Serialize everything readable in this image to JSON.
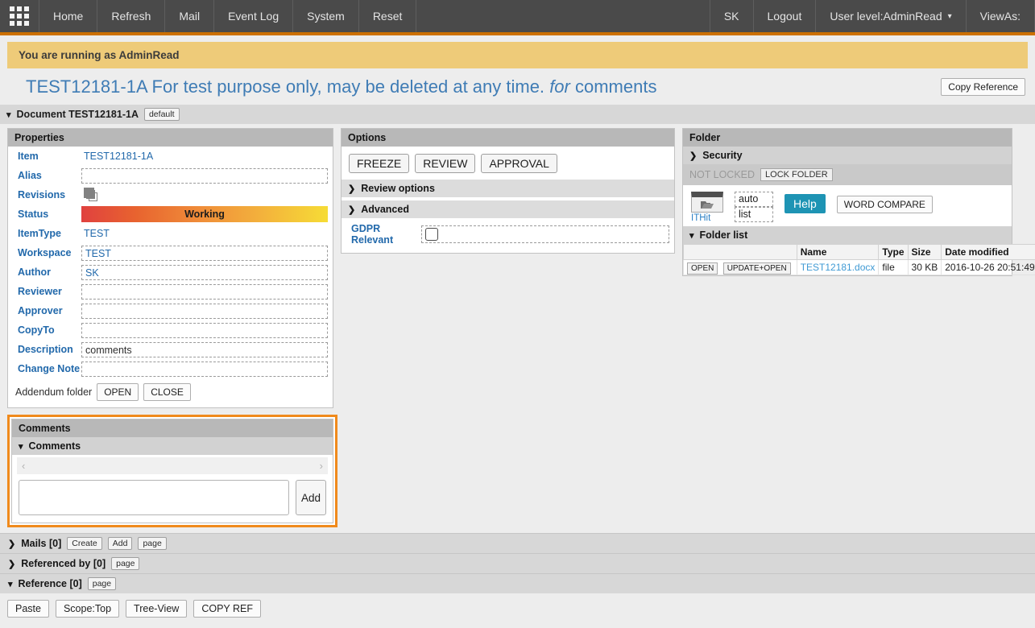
{
  "topnav": {
    "grid_icon": "grid-apps-icon",
    "items": [
      "Home",
      "Refresh",
      "Mail",
      "Event Log",
      "System",
      "Reset"
    ],
    "right_items": [
      "SK",
      "Logout"
    ],
    "user_level": "User level:AdminRead",
    "user_level_caret": "chevron-down-icon",
    "view_as": "ViewAs:",
    "accent_color": "#cc7000",
    "bg_color": "#4a4a4a"
  },
  "banner": {
    "text": "You are running as AdminRead",
    "bg_color": "#eecb79"
  },
  "header": {
    "title_main": "TEST12181-1A For test purpose only, may be deleted at any time.",
    "title_em": "for",
    "title_tail": "comments",
    "copy_reference_label": "Copy Reference"
  },
  "document_section": {
    "twisty": "⌄",
    "label": "Document TEST12181-1A",
    "badge": "default"
  },
  "properties": {
    "header": "Properties",
    "rows": [
      {
        "label": "Item",
        "value": "TEST12181-1A",
        "kind": "text"
      },
      {
        "label": "Alias",
        "value": "",
        "kind": "box"
      },
      {
        "label": "Revisions",
        "value": "",
        "kind": "icon"
      },
      {
        "label": "Status",
        "value": "Working",
        "kind": "status"
      },
      {
        "label": "ItemType",
        "value": "TEST",
        "kind": "text"
      },
      {
        "label": "Workspace",
        "value": "TEST",
        "kind": "box"
      },
      {
        "label": "Author",
        "value": "SK",
        "kind": "box"
      },
      {
        "label": "Reviewer",
        "value": "",
        "kind": "box"
      },
      {
        "label": "Approver",
        "value": "",
        "kind": "box"
      },
      {
        "label": "CopyTo",
        "value": "",
        "kind": "box"
      },
      {
        "label": "Description",
        "value": "comments",
        "kind": "box-dark"
      },
      {
        "label": "Change Note",
        "value": "",
        "kind": "box"
      }
    ],
    "status_gradient": [
      "#e0413f",
      "#f6dc36"
    ],
    "addendum_label": "Addendum folder",
    "addendum_open": "OPEN",
    "addendum_close": "CLOSE",
    "label_color": "#2269ab"
  },
  "options": {
    "header": "Options",
    "buttons": [
      "FREEZE",
      "REVIEW",
      "APPROVAL"
    ],
    "review_options_label": "Review options",
    "advanced_label": "Advanced",
    "gdpr_label": "GDPR Relevant",
    "gdpr_checked": false
  },
  "folder": {
    "header": "Folder",
    "security_label": "Security",
    "lock_status": "NOT LOCKED",
    "lock_button": "LOCK FOLDER",
    "folder_icon": "open-folder-icon",
    "ithit_label": "ITHit",
    "auto_label": "auto",
    "list_label": "list",
    "help_label": "Help",
    "help_color": "#1e94b4",
    "word_compare_label": "WORD COMPARE",
    "folder_list_label": "Folder list",
    "columns": [
      "",
      "Name",
      "Type",
      "Size",
      "Date modified"
    ],
    "rows": [
      {
        "open_label": "OPEN",
        "update_open_label": "UPDATE+OPEN",
        "name": "TEST12181.docx",
        "type": "file",
        "size": "30 KB",
        "date_modified": "2016-10-26 20:51:49"
      }
    ]
  },
  "comments": {
    "header": "Comments",
    "sub_header": "Comments",
    "scroll_left": "‹",
    "scroll_right": "›",
    "input_value": "",
    "input_placeholder": "",
    "add_label": "Add",
    "highlight_color": "#f08a1c"
  },
  "bottom": {
    "mails": {
      "label": "Mails [0]",
      "buttons": [
        "Create",
        "Add",
        "page"
      ],
      "twisty": "›"
    },
    "referenced_by": {
      "label": "Referenced by [0]",
      "buttons": [
        "page"
      ],
      "twisty": "›"
    },
    "reference": {
      "label": "Reference [0]",
      "buttons": [
        "page"
      ],
      "twisty": "⌄"
    },
    "reference_actions": [
      "Paste",
      "Scope:Top",
      "Tree-View",
      "COPY REF"
    ]
  }
}
